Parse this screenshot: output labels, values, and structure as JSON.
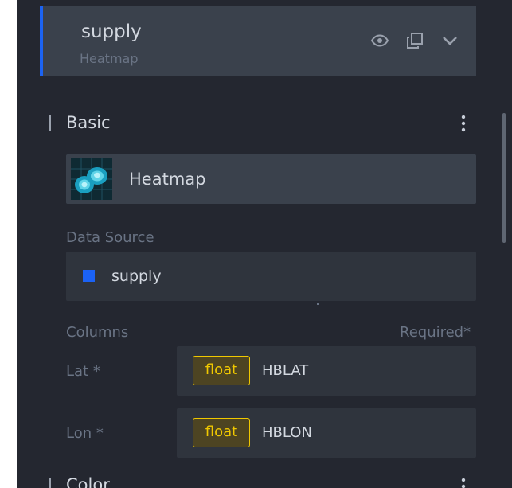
{
  "layer": {
    "name": "supply",
    "type": "Heatmap",
    "accent_color": "#1c63f2",
    "icons": [
      "eye-icon",
      "copy-icon",
      "chevron-down-icon"
    ]
  },
  "basic": {
    "title": "Basic",
    "visualization": {
      "label": "Heatmap",
      "thumbnail": "heatmap-thumbnail"
    }
  },
  "data_source": {
    "label": "Data Source",
    "value": "supply",
    "color": "#1b62f5"
  },
  "columns": {
    "label": "Columns",
    "required_note": "Required*",
    "fields": [
      {
        "label": "Lat *",
        "type": "float",
        "value": "HBLAT"
      },
      {
        "label": "Lon *",
        "type": "float",
        "value": "HBLON"
      }
    ]
  },
  "color_section": {
    "title": "Color"
  }
}
